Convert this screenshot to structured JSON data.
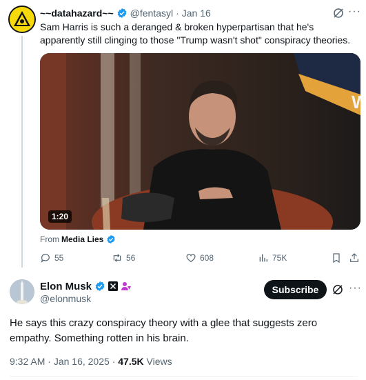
{
  "quoted_post": {
    "author_name": "~~datahazard~~",
    "handle": "@fentasyl",
    "date": "Jan 16",
    "text": "Sam Harris is such a deranged & broken hyperpartisan that he's apparently still clinging to those \"Trump wasn't shot\" conspiracy theories.",
    "video_duration": "1:20",
    "from_label": "From",
    "from_source": "Media Lies",
    "stats": {
      "replies": "55",
      "reposts": "56",
      "likes": "608",
      "views": "75K"
    },
    "media_sign_text": "W"
  },
  "main_post": {
    "author_name": "Elon Musk",
    "handle": "@elonmusk",
    "subscribe_label": "Subscribe",
    "text": "He says this crazy conspiracy theory with a glee that suggests zero empathy. Something rotten in his brain.",
    "time": "9:32 AM",
    "date": "Jan 16, 2025",
    "views_count": "47.5K",
    "views_label": "Views"
  },
  "colors": {
    "verified_blue": "#1d9bf0",
    "text_primary": "#0f1419",
    "text_muted": "#536471",
    "subscribe_bg": "#0f1419",
    "hazard_yellow": "#f5d90a"
  }
}
